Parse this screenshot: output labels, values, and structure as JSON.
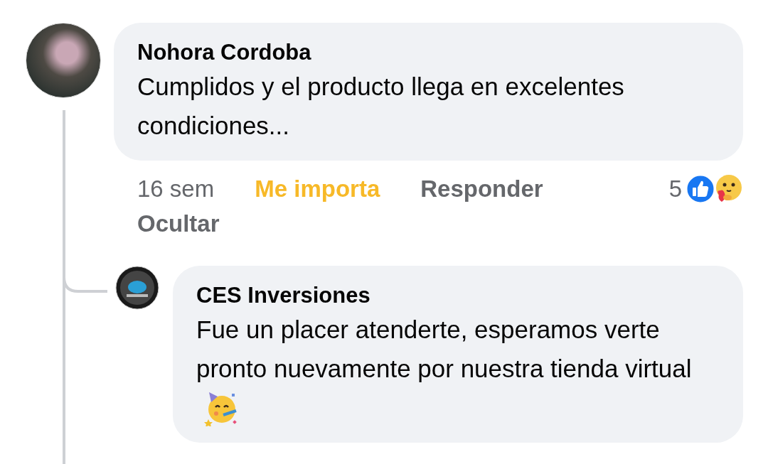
{
  "comment": {
    "author": "Nohora Cordoba",
    "text": "Cumplidos y el producto llega en excelentes condiciones...",
    "time": "16 sem",
    "reaction_label": "Me importa",
    "reacted": true,
    "reply_label": "Responder",
    "reaction_count": "5",
    "hide_label": "Ocultar"
  },
  "reply": {
    "author": "CES Inversiones",
    "text": "Fue un placer atenderte, esperamos verte pronto nuevamente por nuestra tienda virtual"
  }
}
